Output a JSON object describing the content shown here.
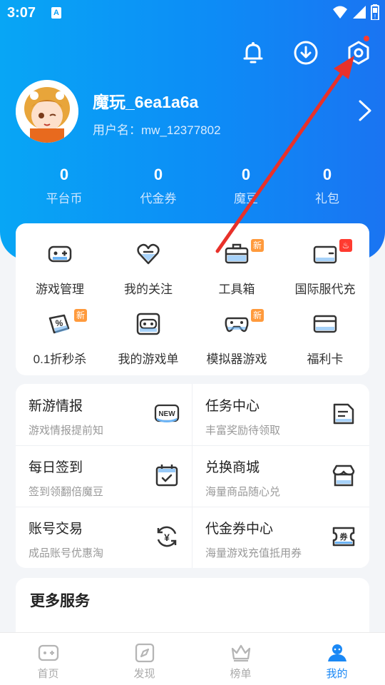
{
  "status_bar": {
    "time": "3:07",
    "notif_letter": "A"
  },
  "profile": {
    "username": "魔玩_6ea1a6a",
    "user_id_label": "用户名：",
    "user_id": "mw_12377802"
  },
  "stats": [
    {
      "value": "0",
      "label": "平台币"
    },
    {
      "value": "0",
      "label": "代金券"
    },
    {
      "value": "0",
      "label": "魔豆"
    },
    {
      "value": "0",
      "label": "礼包"
    }
  ],
  "grid": [
    {
      "label": "游戏管理",
      "icon": "gamepad-icon",
      "tag": ""
    },
    {
      "label": "我的关注",
      "icon": "heart-minus-icon",
      "tag": ""
    },
    {
      "label": "工具箱",
      "icon": "toolbox-icon",
      "tag": "新"
    },
    {
      "label": "国际服代充",
      "icon": "wallet-icon",
      "tag": "hot"
    },
    {
      "label": "0.1折秒杀",
      "icon": "discount-icon",
      "tag": "新"
    },
    {
      "label": "我的游戏单",
      "icon": "game-list-icon",
      "tag": ""
    },
    {
      "label": "模拟器游戏",
      "icon": "emulator-icon",
      "tag": "新"
    },
    {
      "label": "福利卡",
      "icon": "card-icon",
      "tag": ""
    }
  ],
  "services": [
    {
      "title": "新游情报",
      "subtitle": "游戏情报提前知",
      "icon": "new-badge-icon",
      "icon_text": "NEW"
    },
    {
      "title": "任务中心",
      "subtitle": "丰富奖励待领取",
      "icon": "task-doc-icon"
    },
    {
      "title": "每日签到",
      "subtitle": "签到领翻倍魔豆",
      "icon": "calendar-check-icon"
    },
    {
      "title": "兑换商城",
      "subtitle": "海量商品随心兑",
      "icon": "store-icon"
    },
    {
      "title": "账号交易",
      "subtitle": "成品账号优惠淘",
      "icon": "yen-exchange-icon",
      "icon_text": "¥"
    },
    {
      "title": "代金券中心",
      "subtitle": "海量游戏充值抵用券",
      "icon": "voucher-icon",
      "icon_text": "券"
    }
  ],
  "more_services": {
    "title": "更多服务"
  },
  "tabs": [
    {
      "label": "首页",
      "icon": "home-gamepad-icon",
      "active": false
    },
    {
      "label": "发现",
      "icon": "compass-icon",
      "active": false
    },
    {
      "label": "榜单",
      "icon": "crown-icon",
      "active": false
    },
    {
      "label": "我的",
      "icon": "user-icon",
      "active": true
    }
  ],
  "colors": {
    "accent": "#1a88f5",
    "hero_start": "#08a6f5",
    "hero_end": "#1a74f2",
    "annotation_arrow": "#e8312a",
    "tag_new": "#ff9a3c",
    "tag_hot": "#ff3b30"
  }
}
